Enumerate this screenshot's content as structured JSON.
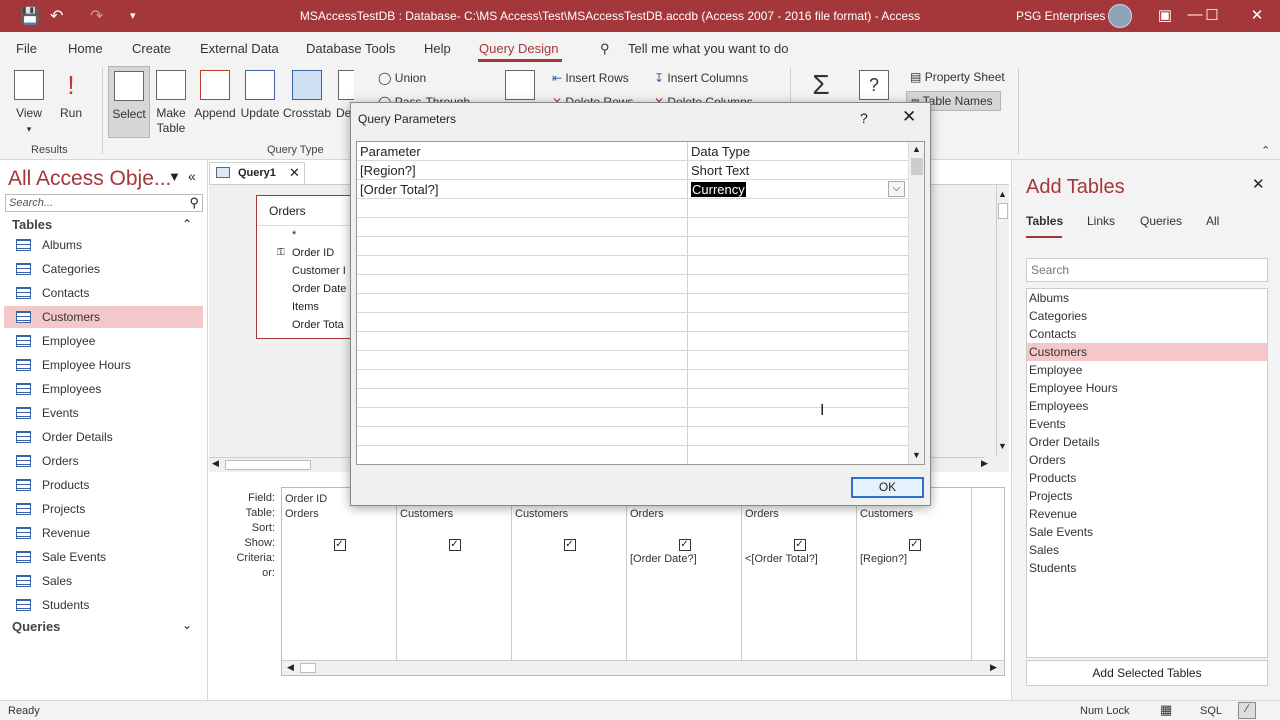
{
  "window": {
    "title": "MSAccessTestDB : Database- C:\\MS Access\\Test\\MSAccessTestDB.accdb (Access 2007 - 2016 file format)  -  Access",
    "user": "PSG Enterprises",
    "qat": [
      "save-icon",
      "undo-icon",
      "redo-icon",
      "customize-icon"
    ],
    "controls": [
      "minimize",
      "maximize",
      "close"
    ]
  },
  "ribbon_tabs": {
    "file": "File",
    "home": "Home",
    "create": "Create",
    "external": "External Data",
    "dbtools": "Database Tools",
    "help": "Help",
    "query_design": "Query Design",
    "tellme": "Tell me what you want to do"
  },
  "ribbon": {
    "view": "View",
    "run": "Run",
    "select": "Select",
    "make_table": "Make\nTable",
    "append": "Append",
    "update": "Update",
    "crosstab": "Crosstab",
    "delete": "De",
    "union": "Union",
    "pass_through": "Pass-Through",
    "insert_rows": "Insert Rows",
    "delete_rows": "Delete Rows",
    "insert_columns": "Insert Columns",
    "delete_columns": "Delete Columns",
    "property_sheet": "Property Sheet",
    "table_names": "Table Names",
    "group_results": "Results",
    "group_query_type": "Query Type"
  },
  "nav": {
    "header": "All Access Obje...",
    "search_placeholder": "Search...",
    "section_tables": "Tables",
    "section_queries": "Queries",
    "items": [
      "Albums",
      "Categories",
      "Contacts",
      "Customers",
      "Employee",
      "Employee Hours",
      "Employees",
      "Events",
      "Order Details",
      "Orders",
      "Products",
      "Projects",
      "Revenue",
      "Sale Events",
      "Sales",
      "Students"
    ],
    "selected": "Customers"
  },
  "query_tab": "Query1",
  "field_list": {
    "title": "Orders",
    "fields": [
      "*",
      "Order ID",
      "Customer I",
      "Order Date",
      "Items",
      "Order Tota"
    ]
  },
  "design_grid": {
    "row_labels": [
      "Field:",
      "Table:",
      "Sort:",
      "Show:",
      "Criteria:",
      "or:"
    ],
    "columns": [
      {
        "field": "Order ID",
        "table": "Orders",
        "show": true,
        "criteria": ""
      },
      {
        "field": "",
        "table": "Customers",
        "show": true,
        "criteria": ""
      },
      {
        "field": "",
        "table": "Customers",
        "show": true,
        "criteria": ""
      },
      {
        "field": "",
        "table": "Orders",
        "show": true,
        "criteria": "[Order Date?]"
      },
      {
        "field": "",
        "table": "Orders",
        "show": true,
        "criteria": "<[Order Total?]"
      },
      {
        "field": "",
        "table": "Customers",
        "show": true,
        "criteria": "[Region?]"
      }
    ]
  },
  "dialog": {
    "title": "Query Parameters",
    "help": "?",
    "col_parameter": "Parameter",
    "col_datatype": "Data Type",
    "rows": [
      {
        "parameter": "[Region?]",
        "type": "Short Text"
      },
      {
        "parameter": "[Order Total?]",
        "type": "Currency"
      }
    ],
    "ok": "OK"
  },
  "add_tables": {
    "title": "Add Tables",
    "tabs": [
      "Tables",
      "Links",
      "Queries",
      "All"
    ],
    "search_placeholder": "Search",
    "items": [
      "Albums",
      "Categories",
      "Contacts",
      "Customers",
      "Employee",
      "Employee Hours",
      "Employees",
      "Events",
      "Order Details",
      "Orders",
      "Products",
      "Projects",
      "Revenue",
      "Sale Events",
      "Sales",
      "Students"
    ],
    "selected": "Customers",
    "add_button": "Add Selected Tables"
  },
  "status": {
    "left": "Ready",
    "numlock": "Num Lock",
    "sql": "SQL"
  },
  "colors": {
    "accent": "#a4373a",
    "selection": "#f4c7c8",
    "ok_border": "#2b70c9"
  }
}
